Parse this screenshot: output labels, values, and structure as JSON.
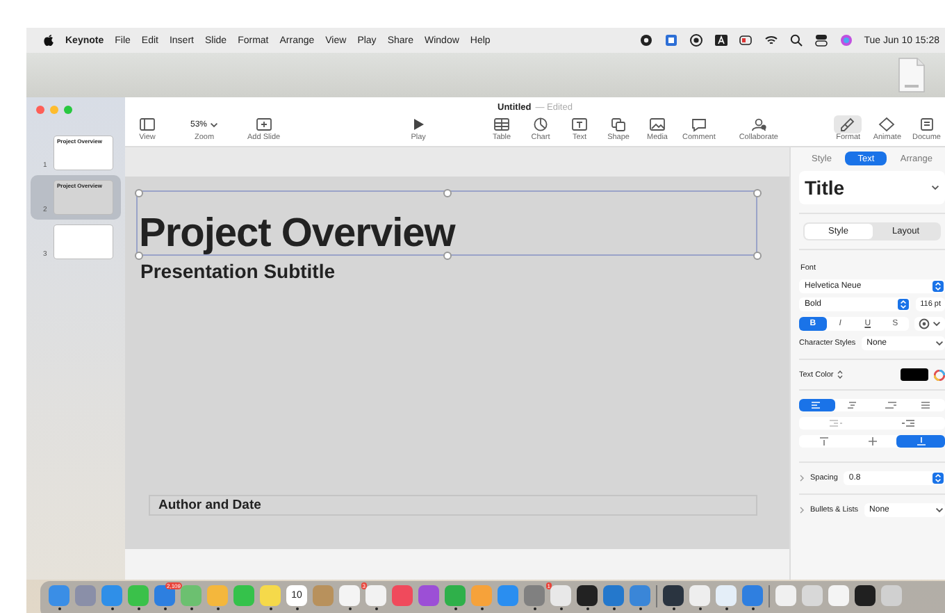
{
  "menu_bar": {
    "app": "Keynote",
    "items": [
      "File",
      "Edit",
      "Insert",
      "Slide",
      "Format",
      "Arrange",
      "View",
      "Play",
      "Share",
      "Window",
      "Help"
    ],
    "clock": "Tue Jun 10  15:28"
  },
  "window": {
    "title": "Untitled",
    "subtitle": "— Edited"
  },
  "toolbar": {
    "left": [
      {
        "kind": "view",
        "label": "View"
      },
      {
        "kind": "zoom",
        "label": "Zoom",
        "value": "53%"
      },
      {
        "kind": "add-slide",
        "label": "Add Slide"
      }
    ],
    "play": {
      "kind": "play",
      "label": "Play"
    },
    "insert": [
      {
        "kind": "table",
        "label": "Table"
      },
      {
        "kind": "chart",
        "label": "Chart"
      },
      {
        "kind": "text",
        "label": "Text"
      },
      {
        "kind": "shape",
        "label": "Shape"
      },
      {
        "kind": "media",
        "label": "Media"
      },
      {
        "kind": "comment",
        "label": "Comment"
      }
    ],
    "collaborate": {
      "kind": "collaborate",
      "label": "Collaborate"
    },
    "inspectors": [
      {
        "kind": "format",
        "label": "Format",
        "selected": true
      },
      {
        "kind": "animate",
        "label": "Animate",
        "selected": false
      },
      {
        "kind": "document",
        "label": "Docume",
        "selected": false
      }
    ]
  },
  "slides": [
    {
      "number": "1",
      "title": "Project Overview",
      "selected": false
    },
    {
      "number": "2",
      "title": "Project Overview",
      "selected": true
    },
    {
      "number": "3",
      "selected": false
    }
  ],
  "slide": {
    "title": "Project Overview",
    "subtitle": "Presentation Subtitle",
    "footer": "Author and Date"
  },
  "inspector": {
    "tabs": [
      {
        "label": "Style",
        "selected": false
      },
      {
        "label": "Text",
        "selected": true
      },
      {
        "label": "Arrange",
        "selected": false
      }
    ],
    "paragraph_style": "Title",
    "segments": [
      {
        "label": "Style",
        "selected": true
      },
      {
        "label": "Layout",
        "selected": false
      }
    ],
    "font_heading": "Font",
    "font_family": "Helvetica Neue",
    "typeface": "Bold",
    "size": "116 pt",
    "styles": [
      {
        "kind": "bold",
        "label": "B",
        "selected": true
      },
      {
        "kind": "italic",
        "label": "I",
        "selected": false
      },
      {
        "kind": "underline",
        "label": "U",
        "selected": false
      },
      {
        "kind": "strike",
        "label": "S",
        "selected": false
      }
    ],
    "character_styles": {
      "label": "Character Styles",
      "value": "None"
    },
    "text_color": {
      "label": "Text Color",
      "color": "#000000"
    },
    "alignment": [
      {
        "kind": "left",
        "selected": true
      },
      {
        "kind": "center",
        "selected": false
      },
      {
        "kind": "right",
        "selected": false
      },
      {
        "kind": "justify",
        "selected": false
      }
    ],
    "indent": [
      {
        "kind": "decrease"
      },
      {
        "kind": "increase"
      }
    ],
    "vertical": [
      {
        "kind": "top",
        "selected": false
      },
      {
        "kind": "middle",
        "selected": false
      },
      {
        "kind": "bottom",
        "selected": true
      }
    ],
    "spacing": {
      "label": "Spacing",
      "value": "0.8"
    },
    "bullets": {
      "label": "Bullets & Lists",
      "value": "None"
    }
  },
  "dock": [
    {
      "color": "#3a8ee6",
      "running": true
    },
    {
      "color": "#8a8fa8",
      "running": false
    },
    {
      "color": "#2f8fe8",
      "running": true
    },
    {
      "color": "#3ac14a",
      "running": true
    },
    {
      "color": "#2d7fe0",
      "running": true,
      "badge": "2,109"
    },
    {
      "color": "#6cc070",
      "running": true
    },
    {
      "color": "#f4b73c",
      "running": true
    },
    {
      "color": "#35c24b",
      "running": false
    },
    {
      "color": "#f5d94a",
      "running": true
    },
    {
      "color": "#ffffff",
      "running": true,
      "text": "10"
    },
    {
      "color": "#b8915c",
      "running": false
    },
    {
      "color": "#f4f4f4",
      "running": true,
      "badge": "3"
    },
    {
      "color": "#f2f2f2",
      "running": true
    },
    {
      "color": "#f04a5c",
      "running": false
    },
    {
      "color": "#9c4fd6",
      "running": false
    },
    {
      "color": "#2fb04a",
      "running": true
    },
    {
      "color": "#f6a23a",
      "running": true
    },
    {
      "color": "#2a8ef0",
      "running": false
    },
    {
      "color": "#808080",
      "running": true,
      "badge": "1"
    },
    {
      "color": "#e8e8e8",
      "running": true
    },
    {
      "color": "#222222",
      "running": true
    },
    {
      "color": "#2478cc",
      "running": true
    },
    {
      "color": "#3a86d8",
      "running": true
    },
    {
      "kind": "divider"
    },
    {
      "color": "#2a3440",
      "running": true
    },
    {
      "color": "#eeeeee",
      "running": true
    },
    {
      "color": "#e4eef8",
      "running": true
    },
    {
      "color": "#2f7fe0",
      "running": true
    },
    {
      "kind": "divider"
    },
    {
      "color": "#f0f0f0",
      "running": false
    },
    {
      "color": "#d8d8d8",
      "running": false
    },
    {
      "color": "#f4f4f4",
      "running": false
    },
    {
      "color": "#202020",
      "running": false
    },
    {
      "color": "#d0d0d0",
      "running": false
    }
  ]
}
